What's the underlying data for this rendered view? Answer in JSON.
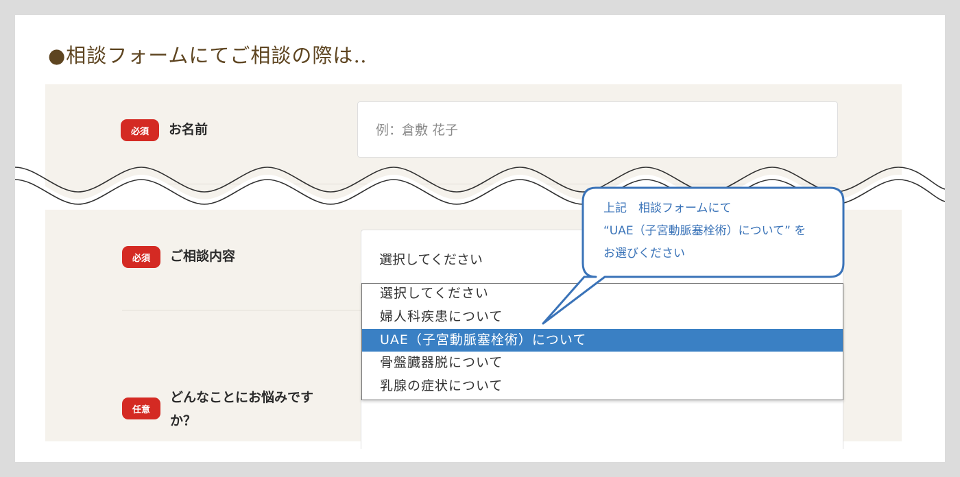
{
  "heading": "●相談フォームにてご相談の際は‥",
  "fields": {
    "name": {
      "badge": "必須",
      "label": "お名前",
      "placeholder": "例：倉敷 花子"
    },
    "consult": {
      "badge": "必須",
      "label": "ご相談内容",
      "selected": "選択してください"
    },
    "worry": {
      "badge": "任意",
      "label_line1": "どんなことにお悩みです",
      "label_line2": "か？"
    }
  },
  "dropdown": {
    "options": [
      "選択してください",
      "婦人科疾患について",
      "UAE（子宮動脈塞栓術）について",
      "骨盤臓器脱について",
      "乳腺の症状について"
    ],
    "highlighted_index": 2
  },
  "callout": {
    "line1": "上記　相談フォームにて",
    "line2": "“UAE（子宮動脈塞栓術）について” を",
    "line3": "お選びください"
  },
  "colors": {
    "badge": "#d42a23",
    "highlight": "#3a80c4",
    "callout_border": "#3a73b8",
    "heading": "#5e4521",
    "form_bg": "#f5f2ec"
  }
}
